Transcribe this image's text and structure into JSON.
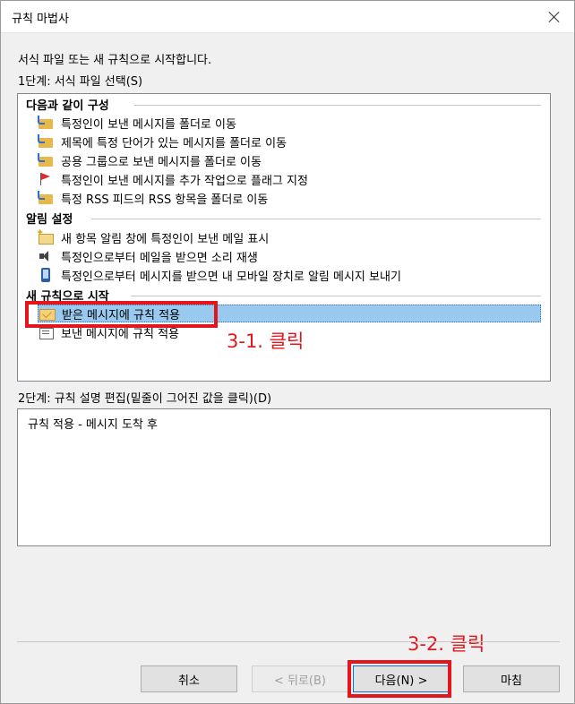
{
  "window": {
    "title": "규칙 마법사"
  },
  "intro_text": "서식 파일 또는 새 규칙으로 시작합니다.",
  "step1_label": "1단계: 서식 파일 선택(S)",
  "groups": [
    {
      "header": "다음과 같이 구성",
      "items": [
        {
          "label": "특정인이 보낸 메시지를 폴더로 이동",
          "icon": "folder-move-icon"
        },
        {
          "label": "제목에 특정 단어가 있는 메시지를 폴더로 이동",
          "icon": "folder-move-icon"
        },
        {
          "label": "공용 그룹으로 보낸 메시지를 폴더로 이동",
          "icon": "folder-move-icon"
        },
        {
          "label": "특정인이 보낸 메시지를 추가 작업으로 플래그 지정",
          "icon": "flag-icon"
        },
        {
          "label": "특정 RSS 피드의 RSS 항목을 폴더로 이동",
          "icon": "folder-move-icon"
        }
      ]
    },
    {
      "header": "알림 설정",
      "items": [
        {
          "label": "새 항목 알림 창에 특정인이 보낸 메일 표시",
          "icon": "envelope-star-icon"
        },
        {
          "label": "특정인으로부터 메일을 받으면 소리 재생",
          "icon": "speaker-icon"
        },
        {
          "label": "특정인으로부터 메시지를 받으면 내 모바일 장치로 알림 메시지 보내기",
          "icon": "phone-icon"
        }
      ]
    },
    {
      "header": "새 규칙으로 시작",
      "items": [
        {
          "label": "받은 메시지에 규칙 적용",
          "icon": "mail-in-icon",
          "selected": true
        },
        {
          "label": "보낸 메시지에 규칙 적용",
          "icon": "mail-out-icon"
        }
      ]
    }
  ],
  "annotations": {
    "click1": "3-1. 클릭",
    "click2": "3-2. 클릭",
    "color": "#e4151c"
  },
  "step2_label": "2단계: 규칙 설명 편집(밑줄이 그어진 값을 클릭)(D)",
  "description": "규칙 적용 - 메시지 도착 후",
  "buttons": {
    "cancel": "취소",
    "back": "< 뒤로(B)",
    "next": "다음(N) >",
    "finish": "마침"
  },
  "colors": {
    "selection": "#99c9ef",
    "accent": "#0078d7"
  }
}
